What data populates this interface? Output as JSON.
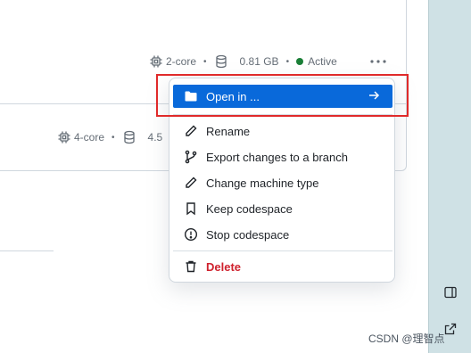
{
  "codespaces": [
    {
      "cores": "2-core",
      "storage": "0.81 GB",
      "status": "Active"
    },
    {
      "cores": "4-core",
      "storage": "4.5"
    }
  ],
  "menu": {
    "items": [
      {
        "label": "Open in ...",
        "icon": "folder-icon"
      },
      {
        "label": "Rename",
        "icon": "pencil-icon"
      },
      {
        "label": "Export changes to a branch",
        "icon": "git-branch-icon"
      },
      {
        "label": "Change machine type",
        "icon": "pencil-icon"
      },
      {
        "label": "Keep codespace",
        "icon": "bookmark-icon"
      },
      {
        "label": "Stop codespace",
        "icon": "alert-circle-icon"
      },
      {
        "label": "Delete",
        "icon": "trash-icon"
      }
    ]
  },
  "watermark": "CSDN @理智点",
  "colors": {
    "accent": "#0969da",
    "danger": "#cf222e",
    "active_status": "#1a7f37",
    "highlight": "#e02a2a",
    "side_panel": "#cfe1e5"
  }
}
